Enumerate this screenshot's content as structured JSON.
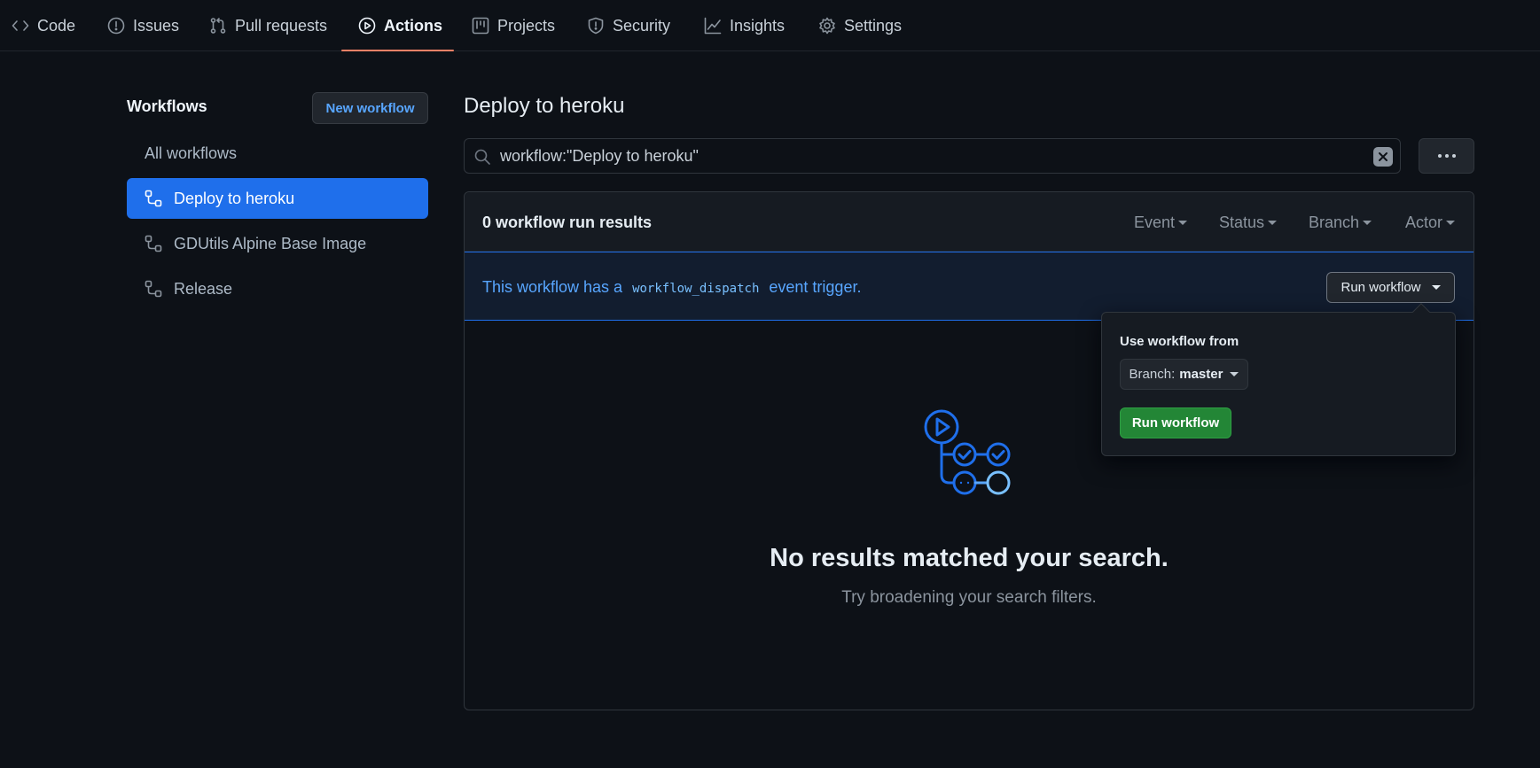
{
  "nav": {
    "tabs": [
      {
        "label": "Code",
        "icon": "code-icon"
      },
      {
        "label": "Issues",
        "icon": "issue-icon"
      },
      {
        "label": "Pull requests",
        "icon": "pull-request-icon"
      },
      {
        "label": "Actions",
        "icon": "play-icon",
        "active": true
      },
      {
        "label": "Projects",
        "icon": "project-icon"
      },
      {
        "label": "Security",
        "icon": "shield-icon"
      },
      {
        "label": "Insights",
        "icon": "graph-icon"
      },
      {
        "label": "Settings",
        "icon": "gear-icon"
      }
    ]
  },
  "sidebar": {
    "title": "Workflows",
    "new_workflow_label": "New workflow",
    "items": [
      {
        "label": "All workflows"
      },
      {
        "label": "Deploy to heroku",
        "active": true
      },
      {
        "label": "GDUtils Alpine Base Image"
      },
      {
        "label": "Release"
      }
    ]
  },
  "main": {
    "title": "Deploy to heroku",
    "search": {
      "value": "workflow:\"Deploy to heroku\""
    },
    "results": {
      "count_label": "0 workflow run results",
      "filters": [
        "Event",
        "Status",
        "Branch",
        "Actor"
      ]
    },
    "dispatch": {
      "text_before": "This workflow has a",
      "code": "workflow_dispatch",
      "text_after": "event trigger.",
      "button_label": "Run workflow"
    },
    "empty": {
      "title": "No results matched your search.",
      "subtitle": "Try broadening your search filters."
    }
  },
  "popover": {
    "label": "Use workflow from",
    "branch_prefix": "Branch:",
    "branch_value": "master",
    "run_label": "Run workflow"
  },
  "colors": {
    "background": "#0d1117",
    "accent": "#1f6feb",
    "link": "#58a6ff",
    "tab_underline": "#f78166",
    "success": "#238636"
  }
}
